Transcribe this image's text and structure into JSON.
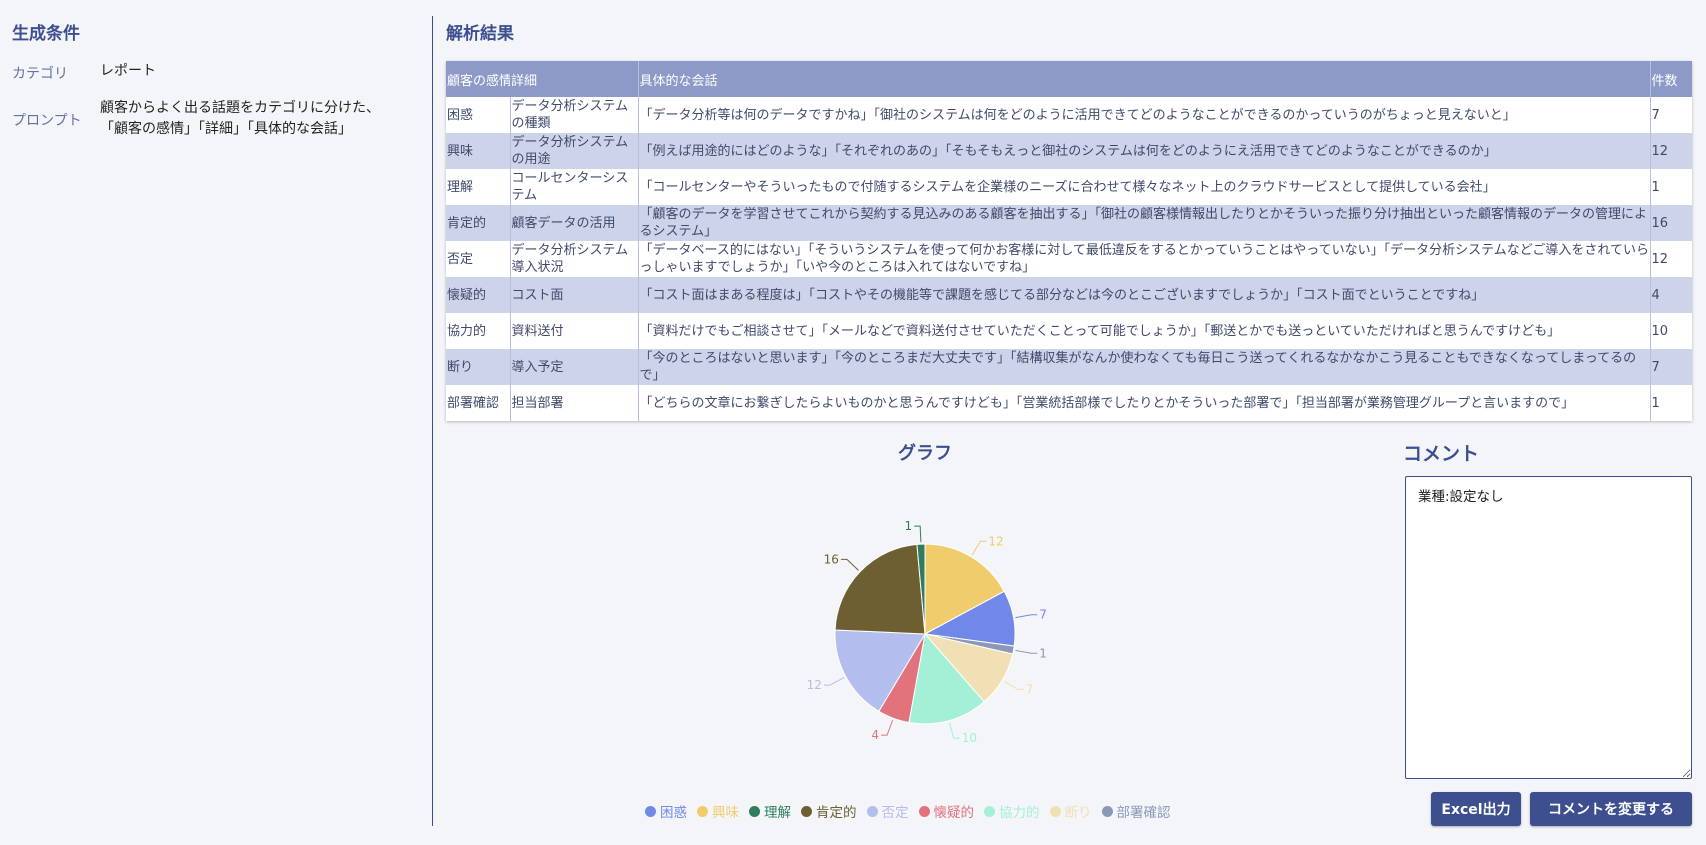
{
  "conditions": {
    "title": "生成条件",
    "category_label": "カテゴリ",
    "category_value": "レポート",
    "prompt_label": "プロンプト",
    "prompt_line1": "顧客からよく出る話題をカテゴリに分けた、",
    "prompt_line2": "「顧客の感情」「詳細」「具体的な会話」"
  },
  "results": {
    "title": "解析結果",
    "headers": [
      "顧客の感情",
      "詳細",
      "具体的な会話",
      "件数"
    ],
    "rows": [
      {
        "emotion": "困惑",
        "detail": "データ分析システムの種類",
        "conversation": "「データ分析等は何のデータですかね」「御社のシステムは何をどのように活用できてどのようなことができるのかっていうのがちょっと見えないと」",
        "count": "7"
      },
      {
        "emotion": "興味",
        "detail": "データ分析システムの用途",
        "conversation": "「例えば用途的にはどのような」「それぞれのあの」「そもそもえっと御社のシステムは何をどのようにえ活用できてどのようなことができるのか」",
        "count": "12"
      },
      {
        "emotion": "理解",
        "detail": "コールセンターシステム",
        "conversation": "「コールセンターやそういったもので付随するシステムを企業様のニーズに合わせて様々なネット上のクラウドサービスとして提供している会社」",
        "count": "1"
      },
      {
        "emotion": "肯定的",
        "detail": "顧客データの活用",
        "conversation": "「顧客のデータを学習させてこれから契約する見込みのある顧客を抽出する」「御社の顧客様情報出したりとかそういった振り分け抽出といった顧客情報のデータの管理によるシステム」",
        "count": "16"
      },
      {
        "emotion": "否定",
        "detail": "データ分析システム導入状況",
        "conversation": "「データベース的にはない」「そういうシステムを使って何かお客様に対して最低違反をするとかっていうことはやっていない」「データ分析システムなどご導入をされていらっしゃいますでしょうか」「いや今のところは入れてはないですね」",
        "count": "12"
      },
      {
        "emotion": "懐疑的",
        "detail": "コスト面",
        "conversation": "「コスト面はまある程度は」「コストやその機能等で課題を感じてる部分などは今のとこございますでしょうか」「コスト面でということですね」",
        "count": "4"
      },
      {
        "emotion": "協力的",
        "detail": "資料送付",
        "conversation": "「資料だけでもご相談させて」「メールなどで資料送付させていただくことって可能でしょうか」「郵送とかでも送っといていただければと思うんですけども」",
        "count": "10"
      },
      {
        "emotion": "断り",
        "detail": "導入予定",
        "conversation": "「今のところはないと思います」「今のところまだ大丈夫です」「結構収集がなんか使わなくても毎日こう送ってくれるなかなかこう見ることもできなくなってしまってるので」",
        "count": "7"
      },
      {
        "emotion": "部署確認",
        "detail": "担当部署",
        "conversation": "「どちらの文章にお繋ぎしたらよいものかと思うんですけども」「営業統括部様でしたりとかそういった部署で」「担当部署が業務管理グループと言いますので」",
        "count": "1"
      }
    ]
  },
  "graph": {
    "title": "グラフ"
  },
  "chart_data": {
    "type": "pie",
    "categories": [
      "困惑",
      "興味",
      "理解",
      "肯定的",
      "否定",
      "懐疑的",
      "協力的",
      "断り",
      "部署確認"
    ],
    "values": [
      7,
      12,
      1,
      16,
      12,
      4,
      10,
      7,
      1
    ],
    "colors": [
      "#7288e8",
      "#f0cc6c",
      "#2e7d5e",
      "#6e5f33",
      "#b3bdee",
      "#e2727c",
      "#a4f0d7",
      "#f1e0b3",
      "#8c98b8"
    ],
    "order_clockwise_from_top": [
      "興味",
      "困惑",
      "部署確認",
      "断り",
      "協力的",
      "懐疑的",
      "否定",
      "肯定的",
      "理解"
    ],
    "legend_position": "bottom"
  },
  "comment": {
    "title": "コメント",
    "value": "業種:設定なし"
  },
  "buttons": {
    "excel": "Excel出力",
    "change_comment": "コメントを変更する"
  }
}
